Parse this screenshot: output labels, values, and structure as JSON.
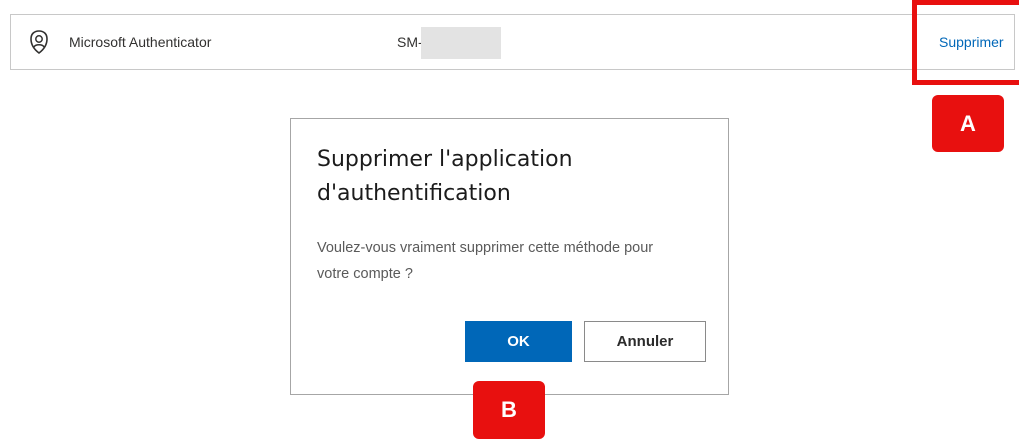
{
  "method": {
    "name": "Microsoft Authenticator",
    "detail": "SM-",
    "delete_label": "Supprimer",
    "icon": "authenticator-lock-icon"
  },
  "dialog": {
    "title": "Supprimer l'application d'authentification",
    "body": "Voulez-vous vraiment supprimer cette méthode pour votre compte ?",
    "ok_label": "OK",
    "cancel_label": "Annuler"
  },
  "annotations": {
    "a": "A",
    "b": "B"
  },
  "colors": {
    "accent": "#0067b8",
    "highlight": "#e8100f"
  }
}
